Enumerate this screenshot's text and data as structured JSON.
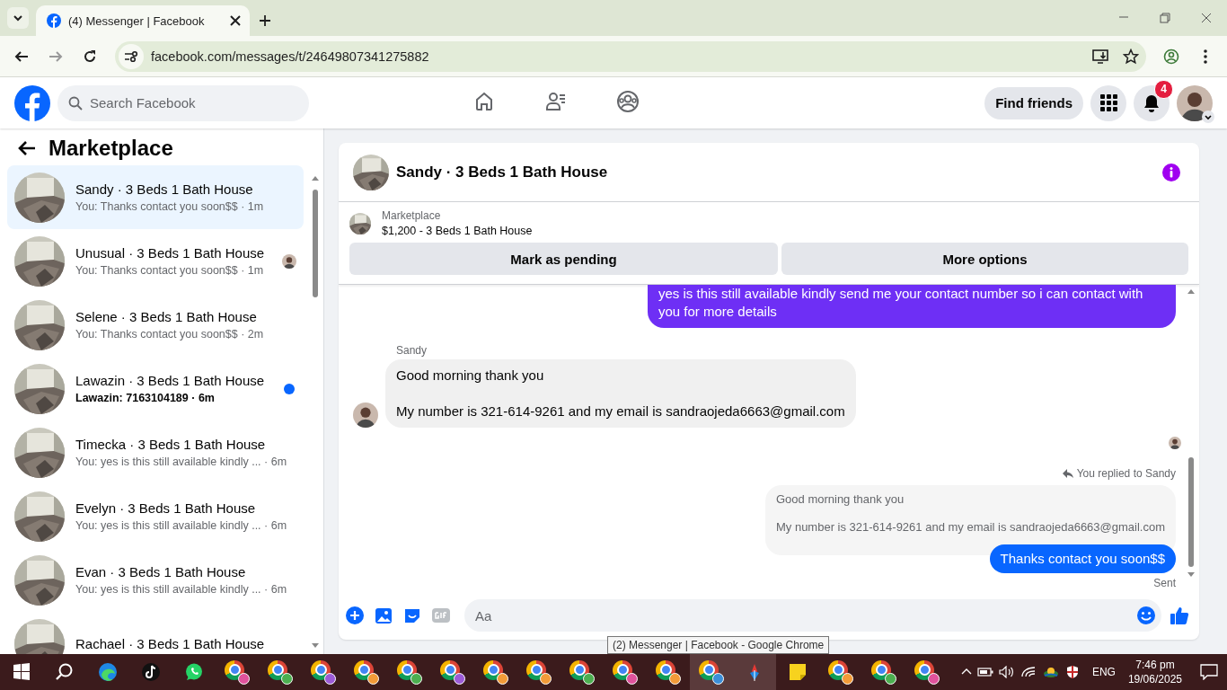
{
  "browser": {
    "tab_title": "(4) Messenger | Facebook",
    "address": "facebook.com/messages/t/24649807341275882"
  },
  "header": {
    "search_placeholder": "Search Facebook",
    "nav": [
      {
        "kind": "home",
        "selected": false
      },
      {
        "kind": "friends",
        "selected": false
      },
      {
        "kind": "groups",
        "selected": false
      }
    ],
    "find_friends": "Find friends",
    "notification_count": "4"
  },
  "sidebar": {
    "title": "Marketplace",
    "conversations": [
      {
        "title": "Sandy · 3 Beds 1 Bath House",
        "preview": "You: Thanks contact you soon$$ · 1m",
        "selected": true,
        "unread": false,
        "seen": false
      },
      {
        "title": "Unusual · 3 Beds 1 Bath House",
        "preview": "You: Thanks contact you soon$$ · 1m",
        "selected": false,
        "unread": false,
        "seen": true
      },
      {
        "title": "Selene · 3 Beds 1 Bath House",
        "preview": "You: Thanks contact you soon$$ · 2m",
        "selected": false,
        "unread": false,
        "seen": false
      },
      {
        "title": "Lawazin · 3 Beds 1 Bath House",
        "preview": "Lawazin: 7163104189 · 6m",
        "selected": false,
        "unread": true,
        "seen": false
      },
      {
        "title": "Timecka · 3 Beds 1 Bath House",
        "preview": "You: yes is this still available kindly ... · 6m",
        "selected": false,
        "unread": false,
        "seen": false
      },
      {
        "title": "Evelyn · 3 Beds 1 Bath House",
        "preview": "You: yes is this still available kindly ... · 6m",
        "selected": false,
        "unread": false,
        "seen": false
      },
      {
        "title": "Evan · 3 Beds 1 Bath House",
        "preview": "You: yes is this still available kindly ... · 6m",
        "selected": false,
        "unread": false,
        "seen": false
      },
      {
        "title": "Rachael · 3 Beds 1 Bath House",
        "selected": false,
        "unread": false,
        "seen": false
      }
    ]
  },
  "chat": {
    "title": "Sandy · 3 Beds 1 Bath House",
    "listing_label": "Marketplace",
    "listing": "$1,200 - 3 Beds 1 Bath House",
    "buttons": [
      "Mark as pending",
      "More options"
    ],
    "messages": [
      {
        "kind": "outgoing",
        "color": "#6e2ff5",
        "text": "yes is this still available kindly send me your contact number so i can contact with you for more details"
      },
      {
        "kind": "incoming",
        "sender": "Sandy",
        "paragraphs": [
          "Good morning thank you",
          "My number is 321-614-9261 and my email is sandraojeda6663@gmail.com"
        ]
      },
      {
        "kind": "seen"
      },
      {
        "kind": "reply",
        "label": "You replied to Sandy",
        "paragraphs": [
          "Good morning thank you",
          "My number is 321-614-9261 and my email is sandraojeda6663@gmail.com"
        ]
      },
      {
        "kind": "outgoing",
        "color": "#0866ff",
        "text": "Thanks contact you soon$$"
      },
      {
        "kind": "status",
        "text": "Sent"
      }
    ],
    "composer_placeholder": "Aa"
  },
  "tooltip": "(2) Messenger | Facebook - Google Chrome",
  "taskbar": {
    "apps": [
      {
        "kind": "start",
        "active": false
      },
      {
        "kind": "search",
        "active": false
      },
      {
        "kind": "edge",
        "active": false
      },
      {
        "kind": "tiktok",
        "active": false
      },
      {
        "kind": "whatsapp",
        "active": false
      },
      {
        "kind": "chrome",
        "color": "#e0529c",
        "active": false
      },
      {
        "kind": "chrome",
        "color": "#4caf50",
        "active": false
      },
      {
        "kind": "chrome",
        "color": "#9c5bd6",
        "active": false
      },
      {
        "kind": "chrome",
        "color": "#f29b38",
        "active": false
      },
      {
        "kind": "chrome",
        "color": "#4caf50",
        "active": false
      },
      {
        "kind": "chrome",
        "color": "#9c5bd6",
        "active": false
      },
      {
        "kind": "chrome",
        "color": "#f29b38",
        "active": false
      },
      {
        "kind": "chrome",
        "color": "#f29b38",
        "active": false
      },
      {
        "kind": "chrome",
        "color": "#4caf50",
        "active": false
      },
      {
        "kind": "chrome",
        "color": "#e0529c",
        "active": false
      },
      {
        "kind": "chrome",
        "color": "#f29b38",
        "active": false
      },
      {
        "kind": "chrome",
        "color": "#3b8fd9",
        "active": true
      },
      {
        "kind": "app",
        "active": true
      },
      {
        "kind": "notes",
        "active": false
      },
      {
        "kind": "chrome",
        "color": "#f29b38",
        "active": false
      },
      {
        "kind": "chrome",
        "color": "#4caf50",
        "active": false
      },
      {
        "kind": "chrome",
        "color": "#e0529c",
        "active": false
      }
    ],
    "language": "ENG",
    "time": "7:46 pm",
    "date": "19/06/2025"
  }
}
